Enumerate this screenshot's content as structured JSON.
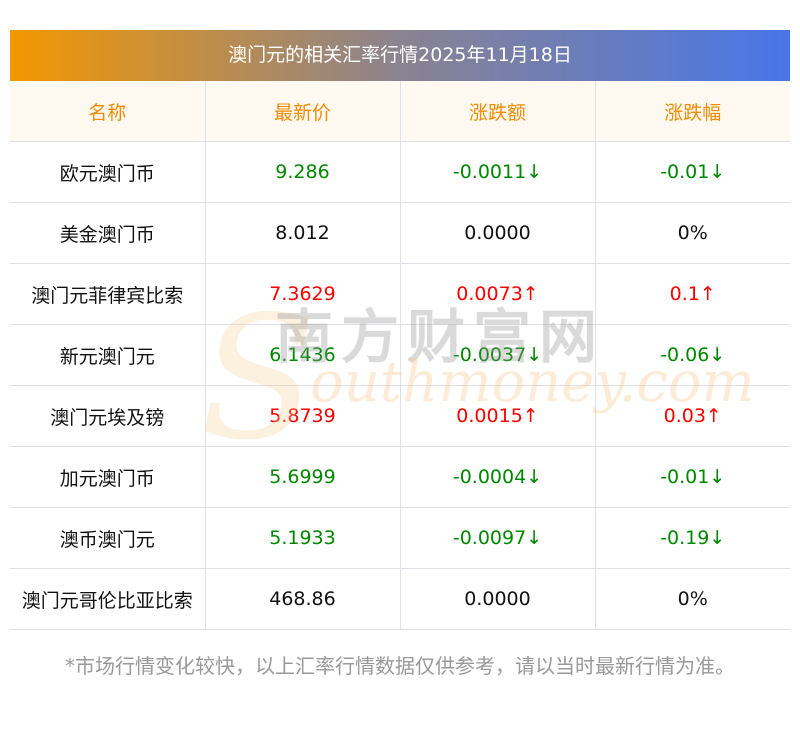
{
  "title": "澳门元的相关汇率行情2025年11月18日",
  "headers": [
    "名称",
    "最新价",
    "涨跌额",
    "涨跌幅"
  ],
  "rows": [
    {
      "name": "欧元澳门币",
      "price": "9.286",
      "change": "-0.0011↓",
      "pct": "-0.01↓",
      "dir": "down"
    },
    {
      "name": "美金澳门币",
      "price": "8.012",
      "change": "0.0000",
      "pct": "0%",
      "dir": "flat"
    },
    {
      "name": "澳门元菲律宾比索",
      "price": "7.3629",
      "change": "0.0073↑",
      "pct": "0.1↑",
      "dir": "up"
    },
    {
      "name": "新元澳门元",
      "price": "6.1436",
      "change": "-0.0037↓",
      "pct": "-0.06↓",
      "dir": "down"
    },
    {
      "name": "澳门元埃及镑",
      "price": "5.8739",
      "change": "0.0015↑",
      "pct": "0.03↑",
      "dir": "up"
    },
    {
      "name": "加元澳门币",
      "price": "5.6999",
      "change": "-0.0004↓",
      "pct": "-0.01↓",
      "dir": "down"
    },
    {
      "name": "澳币澳门元",
      "price": "5.1933",
      "change": "-0.0097↓",
      "pct": "-0.19↓",
      "dir": "down"
    },
    {
      "name": "澳门元哥伦比亚比索",
      "price": "468.86",
      "change": "0.0000",
      "pct": "0%",
      "dir": "flat"
    }
  ],
  "watermark": {
    "cn": "南方财富网",
    "en": "southmoney.com"
  },
  "note": "*市场行情变化较快，以上汇率行情数据仅供参考，请以当时最新行情为准。",
  "colors": {
    "up": "#ff0000",
    "down": "#008800",
    "header": "#f08c00"
  }
}
